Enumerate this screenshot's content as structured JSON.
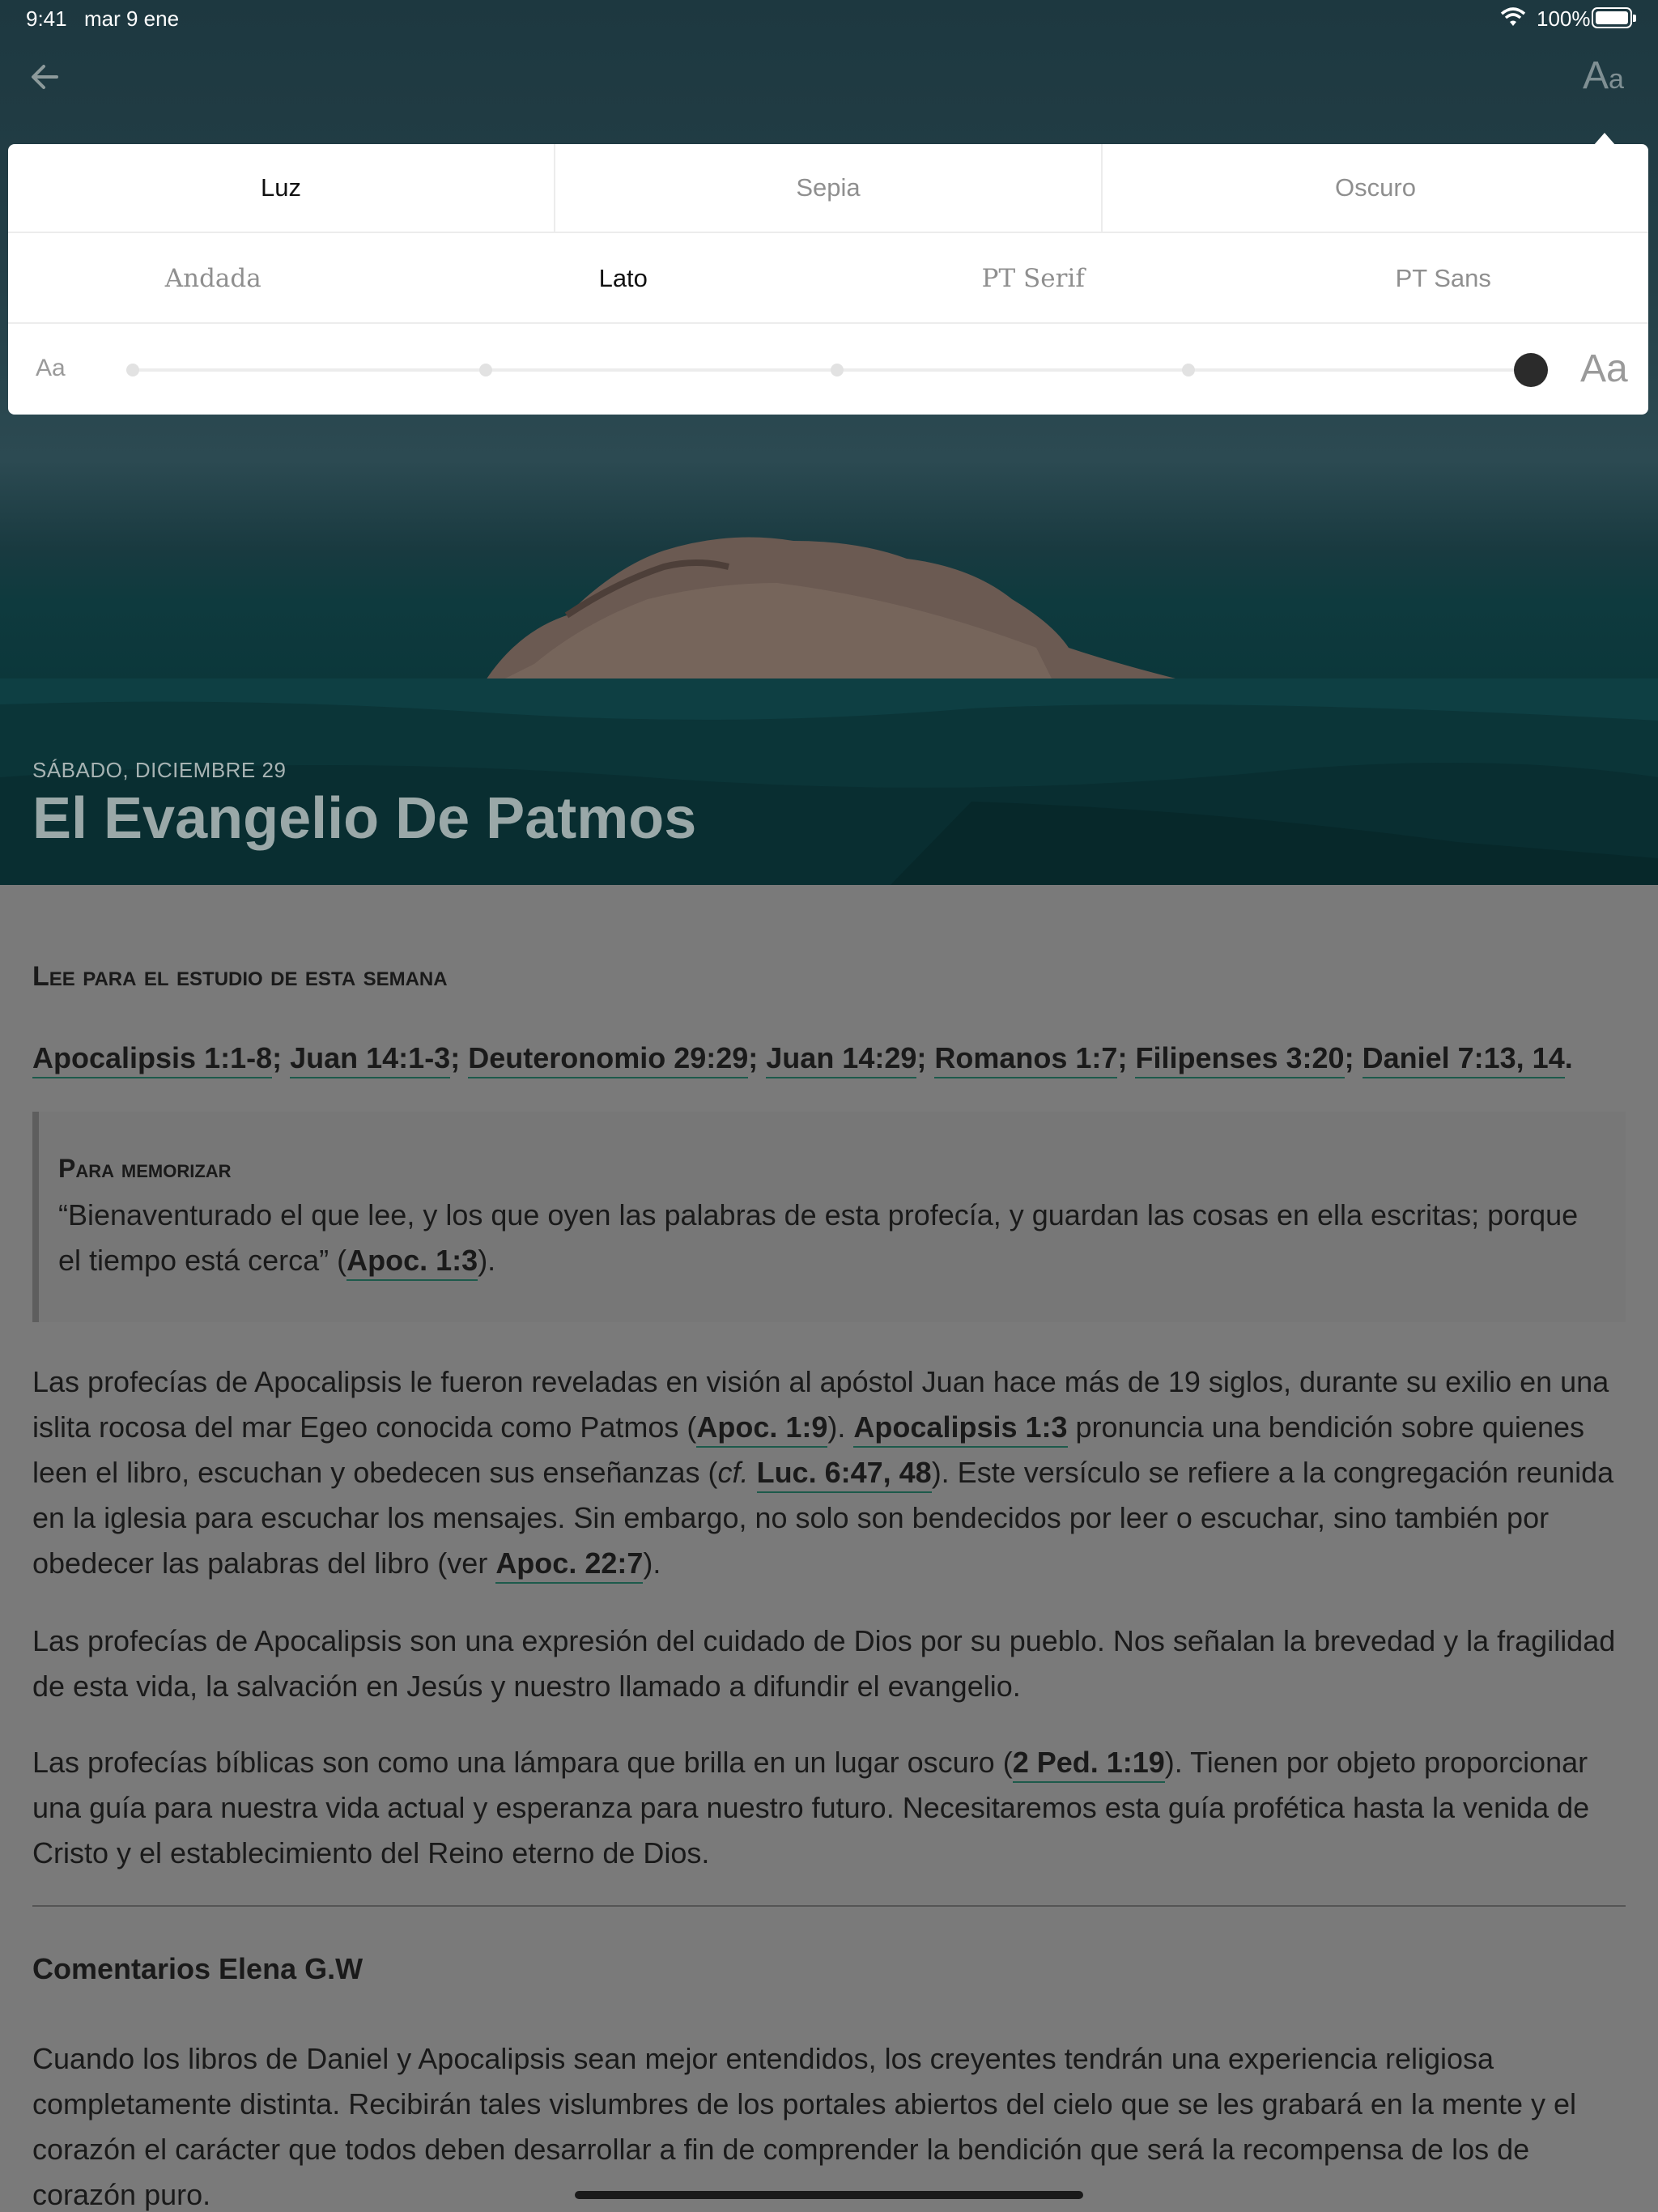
{
  "status_bar": {
    "time": "9:41",
    "date": "mar 9 ene",
    "battery": "100%"
  },
  "nav": {
    "back_icon": "back-arrow-icon",
    "font_button_big": "A",
    "font_button_small": "a"
  },
  "settings": {
    "themes": [
      "Luz",
      "Sepia",
      "Oscuro"
    ],
    "theme_selected": "Luz",
    "fonts": [
      "Andada",
      "Lato",
      "PT Serif",
      "PT Sans"
    ],
    "font_selected": "Lato",
    "size_small_label": "Aa",
    "size_large_label": "Aa",
    "size_steps": 5,
    "size_level": 5
  },
  "hero": {
    "date": "SÁBADO, DICIEMBRE 29",
    "title": "El Evangelio De Patmos"
  },
  "article": {
    "section_heading": "Lee para el estudio de esta semana",
    "refs": [
      "Apocalipsis 1:1-8",
      "Juan 14:1-3",
      "Deuteronomio 29:29",
      "Juan 14:29",
      "Romanos 1:7",
      "Filipenses 3:20",
      "Daniel 7:13, 14"
    ],
    "memo": {
      "heading": "Para memorizar",
      "text": "“Bienaventurado el que lee, y los que oyen las palabras de esta profecía, y guardan las cosas en ella escritas; porque el tiempo está cerca” (",
      "ref": "Apoc. 1:3",
      "text_end": ")."
    },
    "para1": {
      "t1": "Las profecías de Apocalipsis le fueron reveladas en visión al apóstol Juan hace más de 19 siglos, durante su exilio en una islita rocosa del mar Egeo conocida como Patmos (",
      "l1": "Apoc. 1:9",
      "t2": "). ",
      "l2": "Apocalipsis 1:3",
      "t3": " pronuncia una bendición sobre quienes leen el libro, escuchan y obedecen sus enseñanzas (",
      "cf": "cf.",
      "l3": "Luc. 6:47, 48",
      "t4": "). Este versículo se refiere a la congregación reunida en la iglesia para escuchar los mensajes. Sin embargo, no solo son bendecidos por leer o escuchar, sino también por obedecer las palabras del libro (ver ",
      "l4": "Apoc. 22:7",
      "t5": ")."
    },
    "para2": "Las profecías de Apocalipsis son una expresión del cuidado de Dios por su pueblo. Nos señalan la brevedad y la fragilidad de esta vida, la salvación en Jesús y nuestro llamado a difundir el evangelio.",
    "para3": {
      "t1": "Las profecías bíblicas son como una lámpara que brilla en un lugar oscuro (",
      "l1": "2 Ped. 1:19",
      "t2": "). Tienen por objeto proporcionar una guía para nuestra vida actual y esperanza para nuestro futuro. Necesitaremos esta guía profética hasta la venida de Cristo y el establecimiento del Reino eterno de Dios."
    },
    "comments_heading": "Comentarios Elena G.W",
    "para4": "Cuando los libros de Daniel y Apocalipsis sean mejor entendidos, los creyentes tendrán una experiencia religiosa completamente distinta. Recibirán tales vislumbres de los portales abiertos del cielo que se les grabará en la mente y el corazón el carácter que todos deben desarrollar a fin de comprender la bendición que será la recompensa de los de corazón puro."
  }
}
